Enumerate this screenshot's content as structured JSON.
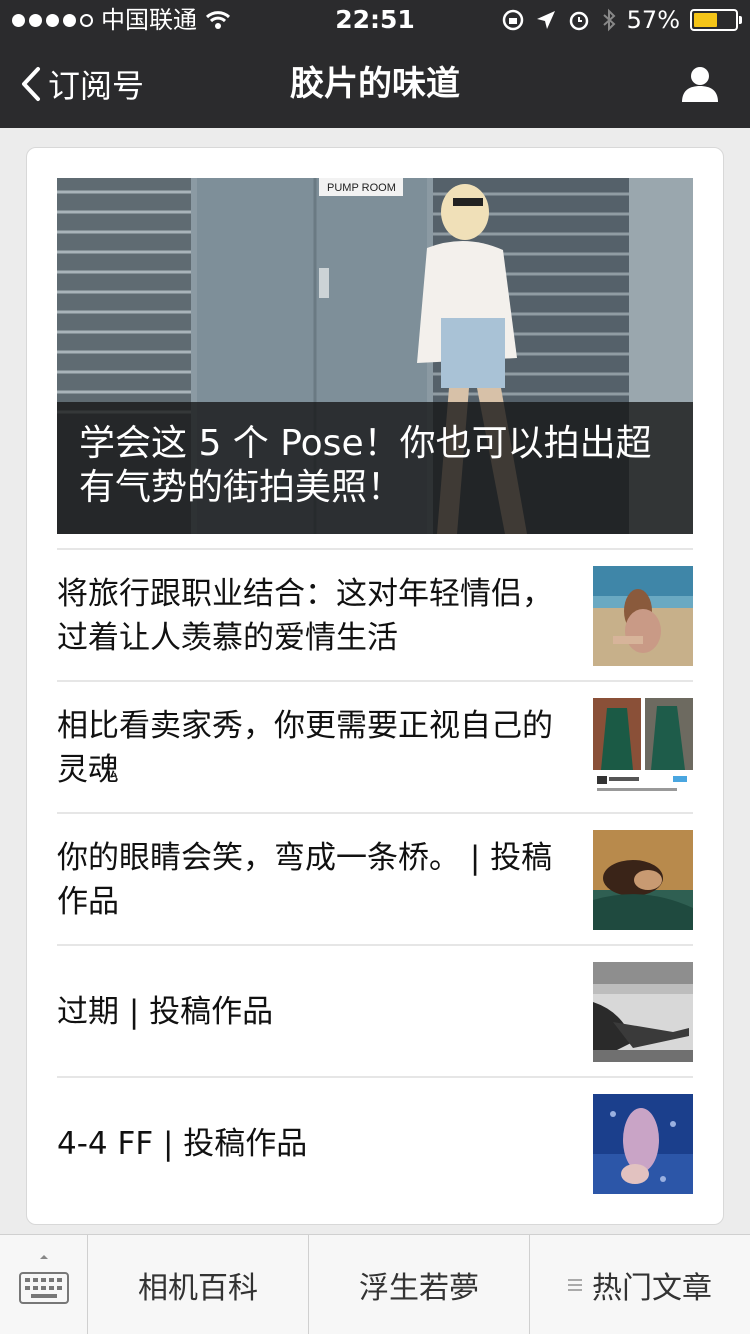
{
  "status": {
    "carrier": "中国联通",
    "time": "22:51",
    "battery": "57%",
    "battery_level": 0.57
  },
  "nav": {
    "back_label": "订阅号",
    "title": "胶片的味道"
  },
  "hero": {
    "sign_text": "PUMP ROOM",
    "caption": "学会这 5 个 Pose！你也可以拍出超有气势的街拍美照！"
  },
  "articles": [
    {
      "title": "将旅行跟职业结合：这对年轻情侣，过着让人羡慕的爱情生活"
    },
    {
      "title": "相比看卖家秀，你更需要正视自己的灵魂"
    },
    {
      "title": "你的眼睛会笑，弯成一条桥。 | 投稿作品"
    },
    {
      "title": "过期 | 投稿作品"
    },
    {
      "title": "4-4 FF | 投稿作品"
    }
  ],
  "menu": {
    "items": [
      {
        "label": "相机百科"
      },
      {
        "label": "浮生若夢"
      },
      {
        "label": "热门文章"
      }
    ]
  },
  "colors": {
    "nav_bg": "#2b2b2d",
    "battery": "#f5c518",
    "caption_bg": "#141414"
  }
}
